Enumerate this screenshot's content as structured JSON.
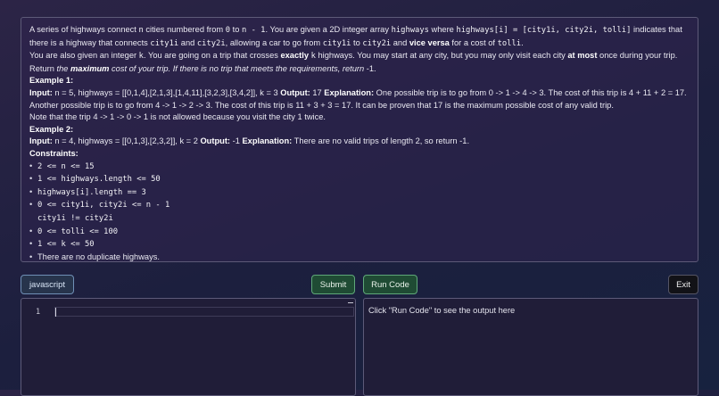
{
  "problem": {
    "p1": {
      "a": "A series of highways connect ",
      "n": "n",
      "b": " cities numbered from ",
      "c0": "0",
      "c": " to ",
      "cn": "n - 1",
      "d": ". You are given a 2D integer array ",
      "hw": "highways",
      "e": " where ",
      "hwi": "highways[i] = [city1i, city2i, tolli]",
      "f": " indicates that there is a highway that connects ",
      "c1": "city1i",
      "g": " and ",
      "c2": "city2i",
      "h": ", allowing a car to go from ",
      "c1b": "city1i",
      "i": " to ",
      "c2b": "city2i",
      "j": " and ",
      "vv": "vice versa",
      "k": " for a cost of ",
      "toll": "tolli",
      "l": "."
    },
    "p2": {
      "a": "You are also given an integer ",
      "k": "k",
      "b": ". You are going on a trip that crosses ",
      "exactly": "exactly",
      "c": " ",
      "k2": "k",
      "d": " highways. You may start at any city, but you may only visit each city ",
      "atmost": "at most",
      "e": " once during your trip."
    },
    "p3": {
      "a": "Return ",
      "the": "the ",
      "maximum": "maximum",
      "b": " cost of your trip. If there is no trip that meets the requirements, return ",
      "m1": "-1",
      "c": "."
    },
    "ex1": {
      "title": "Example 1:",
      "input_label": "Input:",
      "input": " n = 5, highways = [[0,1,4],[2,1,3],[1,4,11],[3,2,3],[3,4,2]], k = 3 ",
      "output_label": "Output:",
      "output": " 17 ",
      "expl_label": "Explanation:",
      "expl": " One possible trip is to go from 0 -> 1 -> 4 -> 3. The cost of this trip is 4 + 11 + 2 = 17. Another possible trip is to go from 4 -> 1 -> 2 -> 3. The cost of this trip is 11 + 3 + 3 = 17. It can be proven that 17 is the maximum possible cost of any valid trip.",
      "note": "Note that the trip 4 -> 1 -> 0 -> 1 is not allowed because you visit the city 1 twice."
    },
    "ex2": {
      "title": "Example 2:",
      "input_label": "Input:",
      "input": " n = 4, highways = [[0,1,3],[2,3,2]], k = 2 ",
      "output_label": "Output:",
      "output": " -1 ",
      "expl_label": "Explanation:",
      "expl": " There are no valid trips of length 2, so return -1."
    },
    "constraints_title": "Constraints:",
    "constraints": [
      "2 <= n <= 15",
      "1 <= highways.length <= 50",
      "highways[i].length == 3",
      "0 <= city1i, city2i <= n - 1",
      "city1i != city2i",
      "0 <= tolli <= 100",
      "1 <= k <= 50",
      "There are no duplicate highways."
    ]
  },
  "toolbar": {
    "language": "javascript",
    "submit": "Submit",
    "run": "Run Code",
    "exit": "Exit"
  },
  "editor": {
    "line_number": "1"
  },
  "output": {
    "placeholder": "Click \"Run Code\" to see the output here"
  }
}
